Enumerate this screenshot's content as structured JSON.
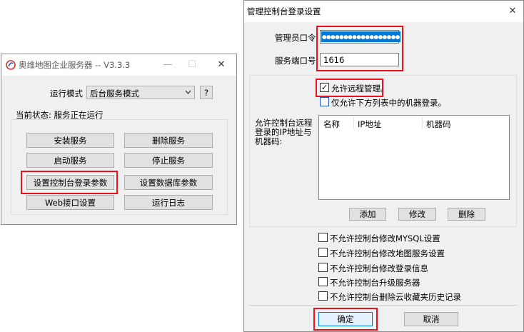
{
  "server_window": {
    "title": "奥维地图企业服务器 -- V3.3.3",
    "window_controls": {
      "minimize": "—",
      "maximize": "☐",
      "close": "✕"
    },
    "run_mode_label": "运行模式",
    "run_mode_value": "后台服务模式",
    "help_label": "?",
    "status_text": "当前状态: 服务正在运行",
    "buttons": {
      "install": "安装服务",
      "remove": "删除服务",
      "start": "启动服务",
      "stop": "停止服务",
      "console_login": "设置控制台登录参数",
      "database": "设置数据库参数",
      "web_interface": "Web接口设置",
      "log": "运行日志"
    }
  },
  "dialog": {
    "title": "管理控制台登录设置",
    "close": "✕",
    "password_label": "管理员口令",
    "password_value": "●●●●●●●●●●●●●●●●●●",
    "port_label": "服务端口号",
    "port_value": "1616",
    "allow_remote_label": "允许远程管理。",
    "allow_remote_checked": true,
    "only_listed_label": "仅允许下方列表中的机器登录。",
    "only_listed_checked": false,
    "list_label": "允许控制台远程登录的IP地址与机器码:",
    "table_headers": [
      "名称",
      "IP地址",
      "机器码"
    ],
    "list_buttons": {
      "add": "添加",
      "edit": "修改",
      "delete": "删除"
    },
    "restrictions": [
      {
        "label": "不允许控制台修改MYSQL设置",
        "checked": false
      },
      {
        "label": "不允许控制台修改地图服务设置",
        "checked": false
      },
      {
        "label": "不允许控制台修改登录信息",
        "checked": false
      },
      {
        "label": "不允许控制台升级服务器",
        "checked": false
      },
      {
        "label": "不允许控制台删除云收藏夹历史记录",
        "checked": false
      }
    ],
    "ok_label": "确定",
    "cancel_label": "取消"
  },
  "colors": {
    "highlight": "#e8141d",
    "selection": "#0078d7",
    "accent": "#1e5bbf"
  }
}
